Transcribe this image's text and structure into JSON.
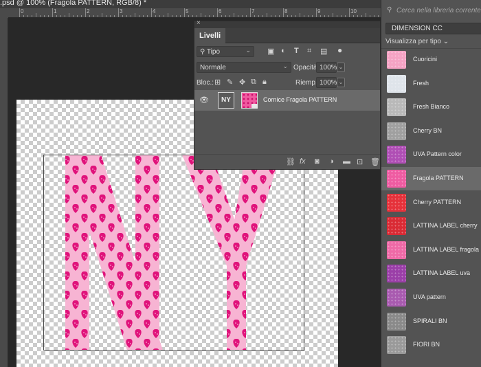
{
  "document": {
    "tab_title": ".psd @ 100% (Fragola PATTERN, RGB/8) *",
    "ruler_labels": [
      "0",
      "1",
      "2",
      "3",
      "4",
      "5",
      "6",
      "7",
      "8",
      "9",
      "10",
      "11"
    ],
    "artwork_text": "NY",
    "colors": {
      "pink_light": "#f7b4d3",
      "pink_dark": "#e0137b"
    }
  },
  "layers_panel": {
    "close_label": "×",
    "tab_label": "Livelli",
    "filter_kind": "Tipo",
    "blend_mode": "Normale",
    "opacity_label": "Opacità:",
    "opacity_value": "100%",
    "lock_label": "Bloc.:",
    "fill_label": "Riemp.:",
    "fill_value": "100%",
    "layer": {
      "thumb_text": "NY",
      "name": "Cornice Fragola PATTERN"
    },
    "bottom_icons": [
      "link-icon",
      "fx-icon",
      "mask-icon",
      "adjustment-icon",
      "folder-icon",
      "new-layer-icon",
      "trash-icon"
    ],
    "fx_label": "fx"
  },
  "library_panel": {
    "search_placeholder": "Cerca nella libreria corrente",
    "library_name": "DIMENSION CC",
    "view_by": "Visualizza per tipo",
    "items": [
      {
        "name": "Cuoricini",
        "color": "#f5a3c4"
      },
      {
        "name": "Fresh",
        "color": "#dfe4ea"
      },
      {
        "name": "Fresh Bianco",
        "color": "#b9b9b9"
      },
      {
        "name": "Cherry BN",
        "color": "#a0a0a0"
      },
      {
        "name": "UVA Pattern color",
        "color": "#b04fb5"
      },
      {
        "name": "Fragola PATTERN",
        "color": "#ef5ca2"
      },
      {
        "name": "Cherry PATTERN",
        "color": "#e5323b"
      },
      {
        "name": "LATTINA LABEL cherry",
        "color": "#d92b35"
      },
      {
        "name": "LATTINA LABEL fragola",
        "color": "#ef6aa7"
      },
      {
        "name": "LATTINA LABEL uva",
        "color": "#9b3fa8"
      },
      {
        "name": "UVA pattern",
        "color": "#a95bb0"
      },
      {
        "name": "SPIRALI BN",
        "color": "#8a8a8a"
      },
      {
        "name": "FIORI BN",
        "color": "#9a9a9a"
      }
    ],
    "selected_index": 5
  }
}
